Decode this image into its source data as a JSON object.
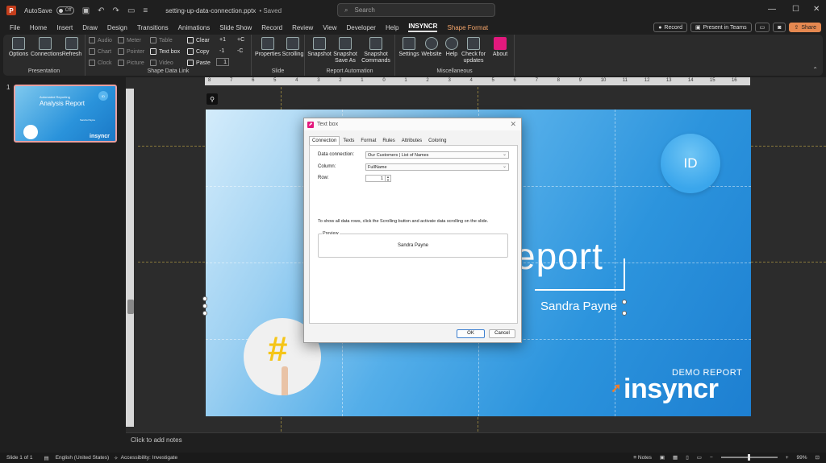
{
  "titlebar": {
    "logo": "P",
    "autosave_label": "AutoSave",
    "autosave_state": "Off",
    "file_name": "setting-up-data-connection.pptx",
    "saved_status": "• Saved",
    "search_placeholder": "Search"
  },
  "menu": {
    "tabs": [
      "File",
      "Home",
      "Insert",
      "Draw",
      "Design",
      "Transitions",
      "Animations",
      "Slide Show",
      "Record",
      "Review",
      "View",
      "Developer",
      "Help",
      "INSYNCR",
      "Shape Format"
    ],
    "active_tab": "INSYNCR",
    "record_label": "Record",
    "present_label": "Present in Teams",
    "share_label": "Share"
  },
  "ribbon": {
    "presentation": {
      "label": "Presentation",
      "options": "Options",
      "connections": "Connections",
      "refresh": "Refresh"
    },
    "shape_data_link": {
      "label": "Shape Data Link",
      "audio": "Audio",
      "chart": "Chart",
      "clock": "Clock",
      "meter": "Meter",
      "pointer": "Pointer",
      "picture": "Picture",
      "table": "Table",
      "textbox": "Text box",
      "video": "Video",
      "clear": "Clear",
      "copy": "Copy",
      "paste": "Paste",
      "plus1": "+1",
      "minus1": "-1",
      "spin_value": "1",
      "plusC": "+C",
      "minusC": "-C"
    },
    "slide": {
      "label": "Slide",
      "properties": "Properties",
      "scrolling": "Scrolling"
    },
    "report_automation": {
      "label": "Report Automation",
      "snapshot": "Snapshot",
      "snapshot_save_as_1": "Snapshot",
      "snapshot_save_as_2": "Save As",
      "snapshot_commands_1": "Snapshot",
      "snapshot_commands_2": "Commands"
    },
    "misc": {
      "label": "Miscellaneous",
      "settings": "Settings",
      "website": "Website",
      "help": "Help",
      "check_1": "Check for",
      "check_2": "updates",
      "about": "About"
    }
  },
  "thumbnails": {
    "slide_number": "1",
    "thumb_small": "Automated Reporting",
    "thumb_title": "Analysis Report",
    "thumb_name": "Sandra Payne",
    "thumb_id": "ID",
    "thumb_logo": "insyncr"
  },
  "ruler": {
    "ticks": [
      "8",
      "7",
      "6",
      "5",
      "4",
      "3",
      "2",
      "1",
      "0",
      "1",
      "2",
      "3",
      "4",
      "5",
      "6",
      "7",
      "8",
      "9",
      "10",
      "11",
      "12",
      "13",
      "14",
      "15",
      "16"
    ]
  },
  "slide": {
    "id_badge": "ID",
    "title_visible": "eport",
    "name": "Sandra Payne",
    "demo_label": "DEMO REPORT",
    "logo": "insyncr"
  },
  "dialog": {
    "title": "Text box",
    "tabs": [
      "Connection",
      "Texts",
      "Format",
      "Rules",
      "Attributes",
      "Coloring"
    ],
    "active_tab": "Connection",
    "data_connection_label": "Data connection:",
    "data_connection_value": "Our Customers | List of Names",
    "column_label": "Column:",
    "column_value": "FullName",
    "row_label": "Row:",
    "row_value": "1",
    "hint": "To show all data rows, click the Scrolling button and activate data scrolling on the slide.",
    "preview_label": "Preview",
    "preview_value": "Sandra Payne",
    "ok_label": "OK",
    "cancel_label": "Cancel"
  },
  "notes": {
    "placeholder": "Click to add notes"
  },
  "status": {
    "slide_info": "Slide 1 of 1",
    "language": "English (United States)",
    "accessibility": "Accessibility: Investigate",
    "notes_label": "Notes",
    "zoom": "99%"
  }
}
